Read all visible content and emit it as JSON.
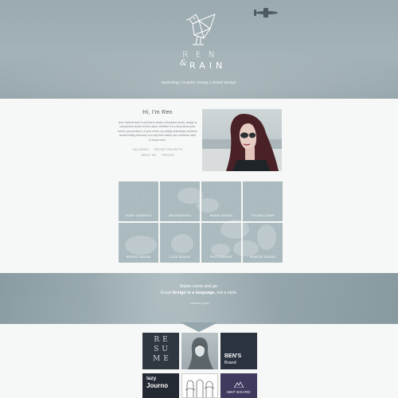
{
  "header": {
    "logo_word1": "REN",
    "logo_amp": "&",
    "logo_word2": "RAIN",
    "tagline": "Marketing | Graphic Design | Brand Design"
  },
  "intro": {
    "title": "Hi, I'm Ren",
    "body": "And I believe that if a picture is worth a thousand words, design is using those words to tell a story. Whether it's a story about your brand, your product, or your event, my design philosophy revolves around telling that story in a way that makes your audience want to know more.",
    "links": [
      "GALLERIES",
      "RECENT PROJECTS",
      "ABOUT ME",
      "PRICING"
    ]
  },
  "services": [
    "EVENT GRAPHICS",
    "INFOGRAPHICS",
    "BRAND DESIGN",
    "FOR MAILCHIMP",
    "REPORT DESIGN",
    "LOGO DESIGN",
    "PHOTOGRAPHY",
    "WEBSITE DESIGN"
  ],
  "quote": {
    "line1": "Styles come and go.",
    "line2_pre": "Good ",
    "line2_bold": "design is a language,",
    "line2_post": " not a style.",
    "author": "- massimo vignelli"
  },
  "portfolio": {
    "resume": [
      "RE",
      "SU",
      "ME"
    ],
    "bens_title": "BEN'S",
    "bens_sub": "Brand",
    "lazy_title": "lazy",
    "lazy_sub": "Journo",
    "mep": "MEP BOARD"
  },
  "colors": {
    "hero": "#9aaab0",
    "tile": "#a9b9be",
    "band": "#93a4aa"
  }
}
